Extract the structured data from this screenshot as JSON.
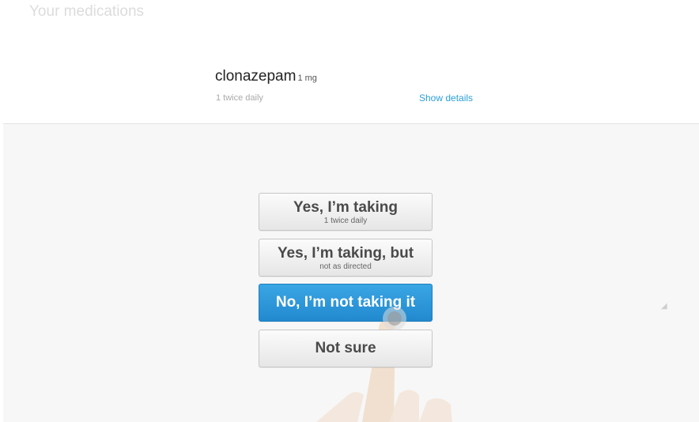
{
  "header": {
    "title": "Your medications"
  },
  "medication": {
    "name": "clonazepam",
    "dose": "1 mg",
    "frequency": "1 twice daily",
    "details_link": "Show details"
  },
  "choices": [
    {
      "label": "Yes, I’m taking",
      "sub": "1 twice daily",
      "state": "default"
    },
    {
      "label": "Yes, I’m taking, but",
      "sub": "not as directed",
      "state": "default"
    },
    {
      "label": "No, I’m not taking it",
      "state": "selected"
    },
    {
      "label": "Not sure",
      "state": "default"
    }
  ],
  "colors": {
    "accent": "#2a9fd8",
    "selected_button": "#2a94d8"
  },
  "icons": {
    "resize": "resize-handle-icon",
    "touch": "touch-hand-icon"
  }
}
